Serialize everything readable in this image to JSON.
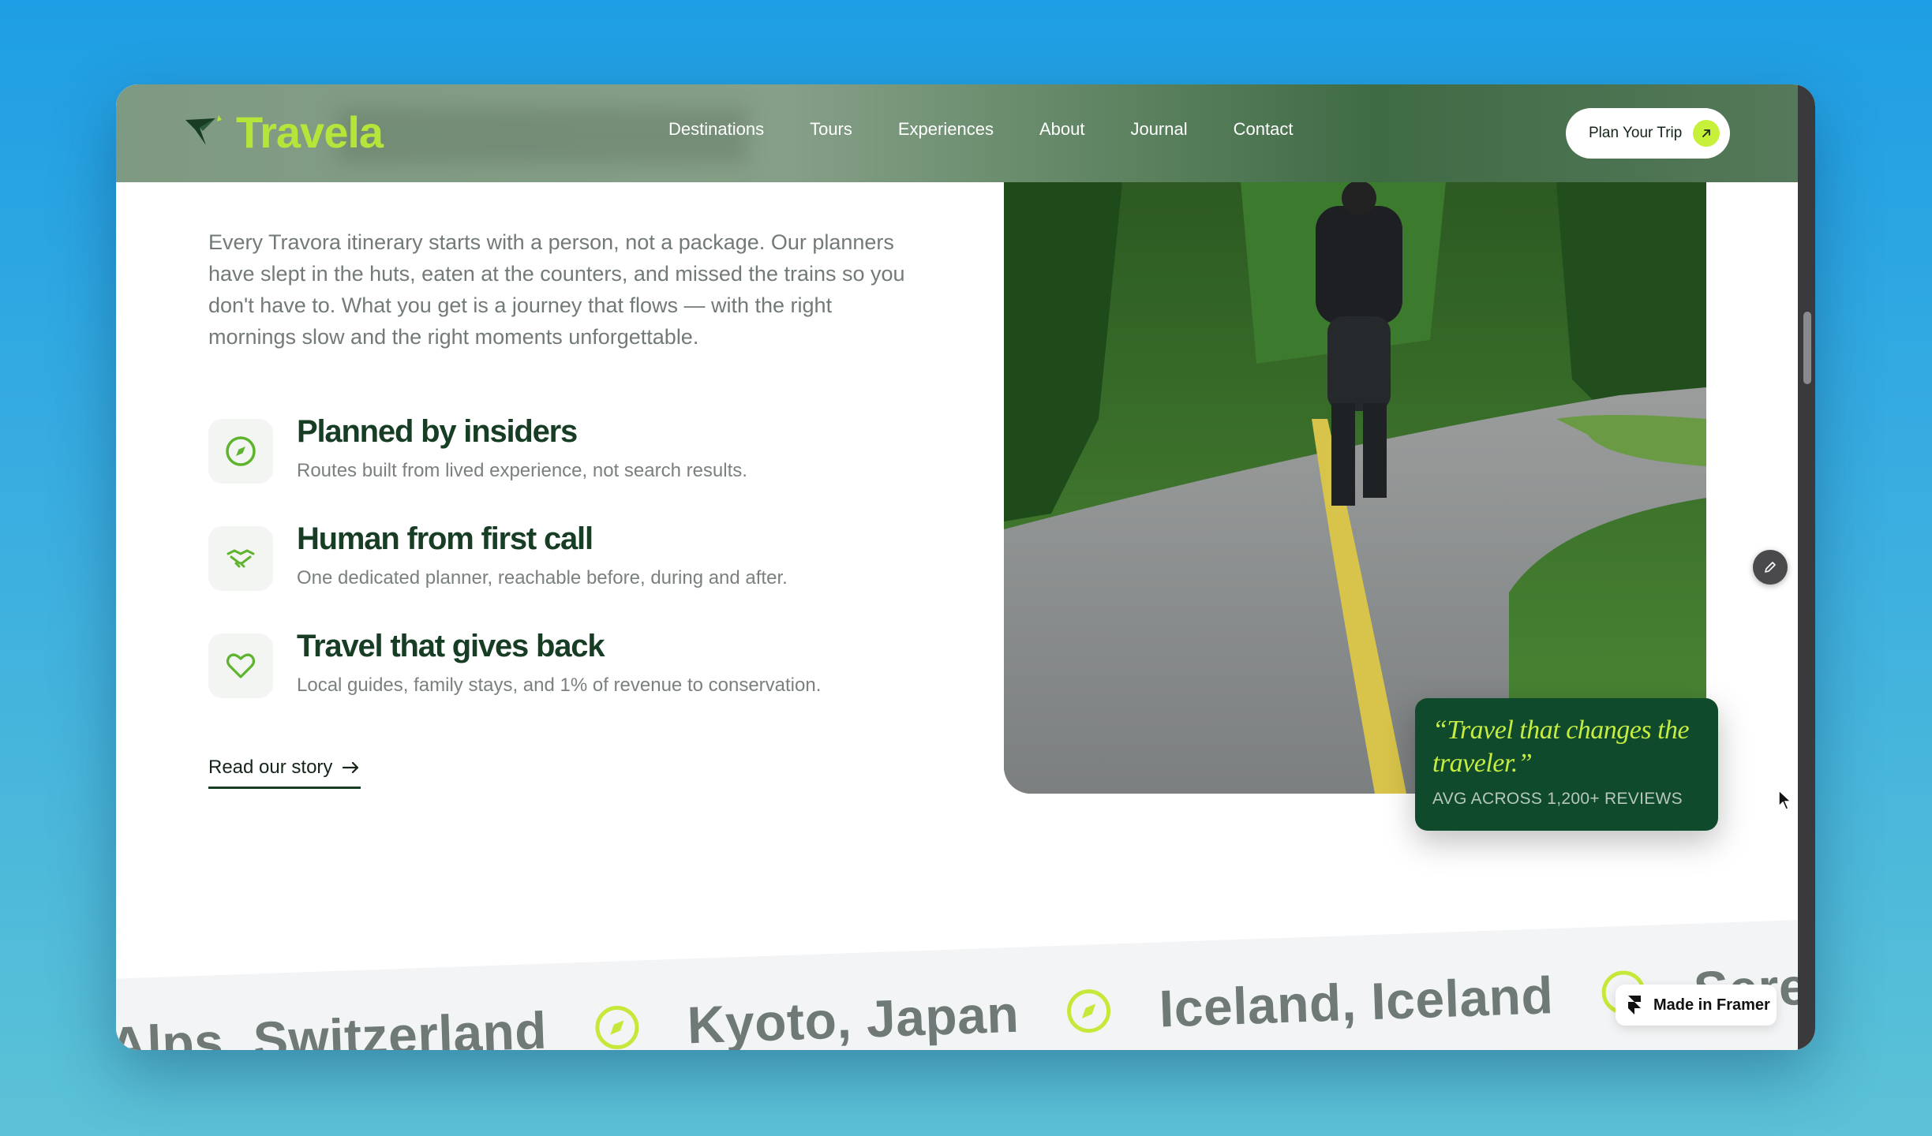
{
  "header": {
    "logo_text": "Travela",
    "nav": [
      "Destinations",
      "Tours",
      "Experiences",
      "About",
      "Journal",
      "Contact"
    ],
    "cta_label": "Plan Your Trip"
  },
  "intro": "Every Travora itinerary starts with a person, not a package. Our planners have slept in the huts, eaten at the counters, and missed the trains so you don't have to. What you get is a journey that flows — with the right mornings slow and the right moments unforgettable.",
  "features": [
    {
      "icon": "compass-icon",
      "title": "Planned by insiders",
      "desc": "Routes built from lived experience, not search results."
    },
    {
      "icon": "handshake-icon",
      "title": "Human from first call",
      "desc": "One dedicated planner, reachable before, during and after."
    },
    {
      "icon": "heart-icon",
      "title": "Travel that gives back",
      "desc": "Local guides, family stays, and 1% of revenue to conservation."
    }
  ],
  "read_link": "Read our story",
  "quote": {
    "text": "“Travel that changes the traveler.”",
    "sub": "AVG ACROSS 1,200+ REVIEWS"
  },
  "marquee": [
    "Alps, Switzerland",
    "Kyoto, Japan",
    "Iceland, Iceland",
    "Serengeti"
  ],
  "badge": "Made in Framer",
  "colors": {
    "brand_green": "#173d25",
    "accent_lime": "#c6f03a",
    "card_green": "#0f4a2c"
  }
}
